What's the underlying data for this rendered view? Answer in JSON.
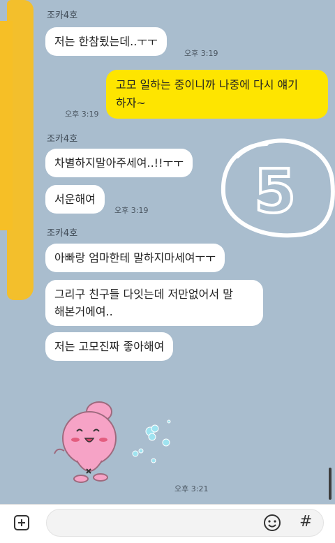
{
  "messages": {
    "sender_name": "조카4호",
    "m1": "저는 한참됬는데..ㅜㅜ",
    "t1": "오후 3:19",
    "m2": "고모 일하는 중이니까 나중에 다시 얘기\n하자~",
    "t2": "오후 3:19",
    "m3": "차별하지말아주세여..!!ㅜㅜ",
    "m4": "서운해여",
    "t4": "오후 3:19",
    "m5": "아빠랑 엄마한테 말하지마세여ㅜㅜ",
    "m6": "그리구 친구들 다잇는데 저만없어서 말\n해본거에여..",
    "m7": "저는 고모진짜 좋아해여",
    "t7": "오후 3:21"
  },
  "annotation": {
    "number": "5"
  },
  "input_bar": {
    "placeholder": "",
    "hash_symbol": "#"
  },
  "icons": {
    "attach": "plus-icon",
    "emoticon": "emoticon-icon",
    "sticker": "pink-bunny-sticker"
  }
}
